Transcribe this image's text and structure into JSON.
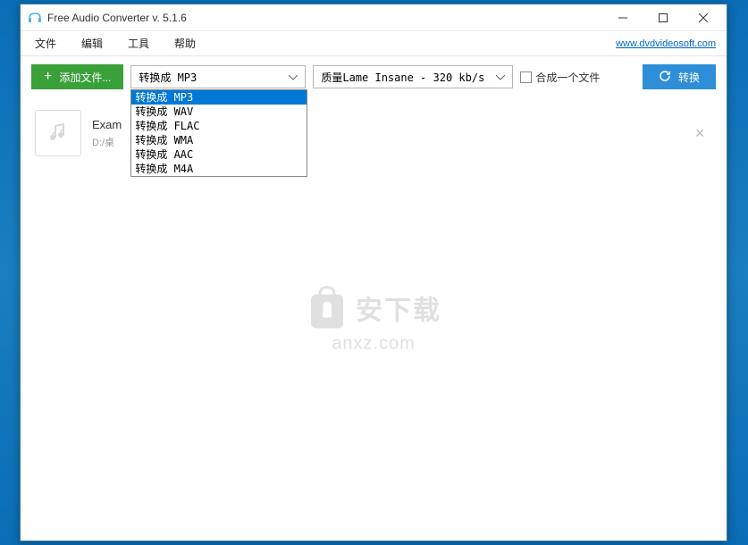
{
  "window": {
    "title": "Free Audio Converter v. 5.1.6"
  },
  "menubar": {
    "file": "文件",
    "edit": "编辑",
    "tools": "工具",
    "help": "帮助",
    "link": "www.dvdvideosoft.com"
  },
  "toolbar": {
    "add_label": "添加文件...",
    "format_selected": "转换成 MP3",
    "quality_label": "质量Lame Insane - 320 kb/s",
    "merge_label": "合成一个文件",
    "convert_label": "转换"
  },
  "format_options": [
    "转换成 MP3",
    "转换成 WAV",
    "转换成 FLAC",
    "转换成 WMA",
    "转换成 AAC",
    "转换成 M4A"
  ],
  "file": {
    "name": "Exam",
    "path": "D:/桌"
  },
  "watermark": {
    "text1": "安下载",
    "text2": "anxz.com"
  }
}
